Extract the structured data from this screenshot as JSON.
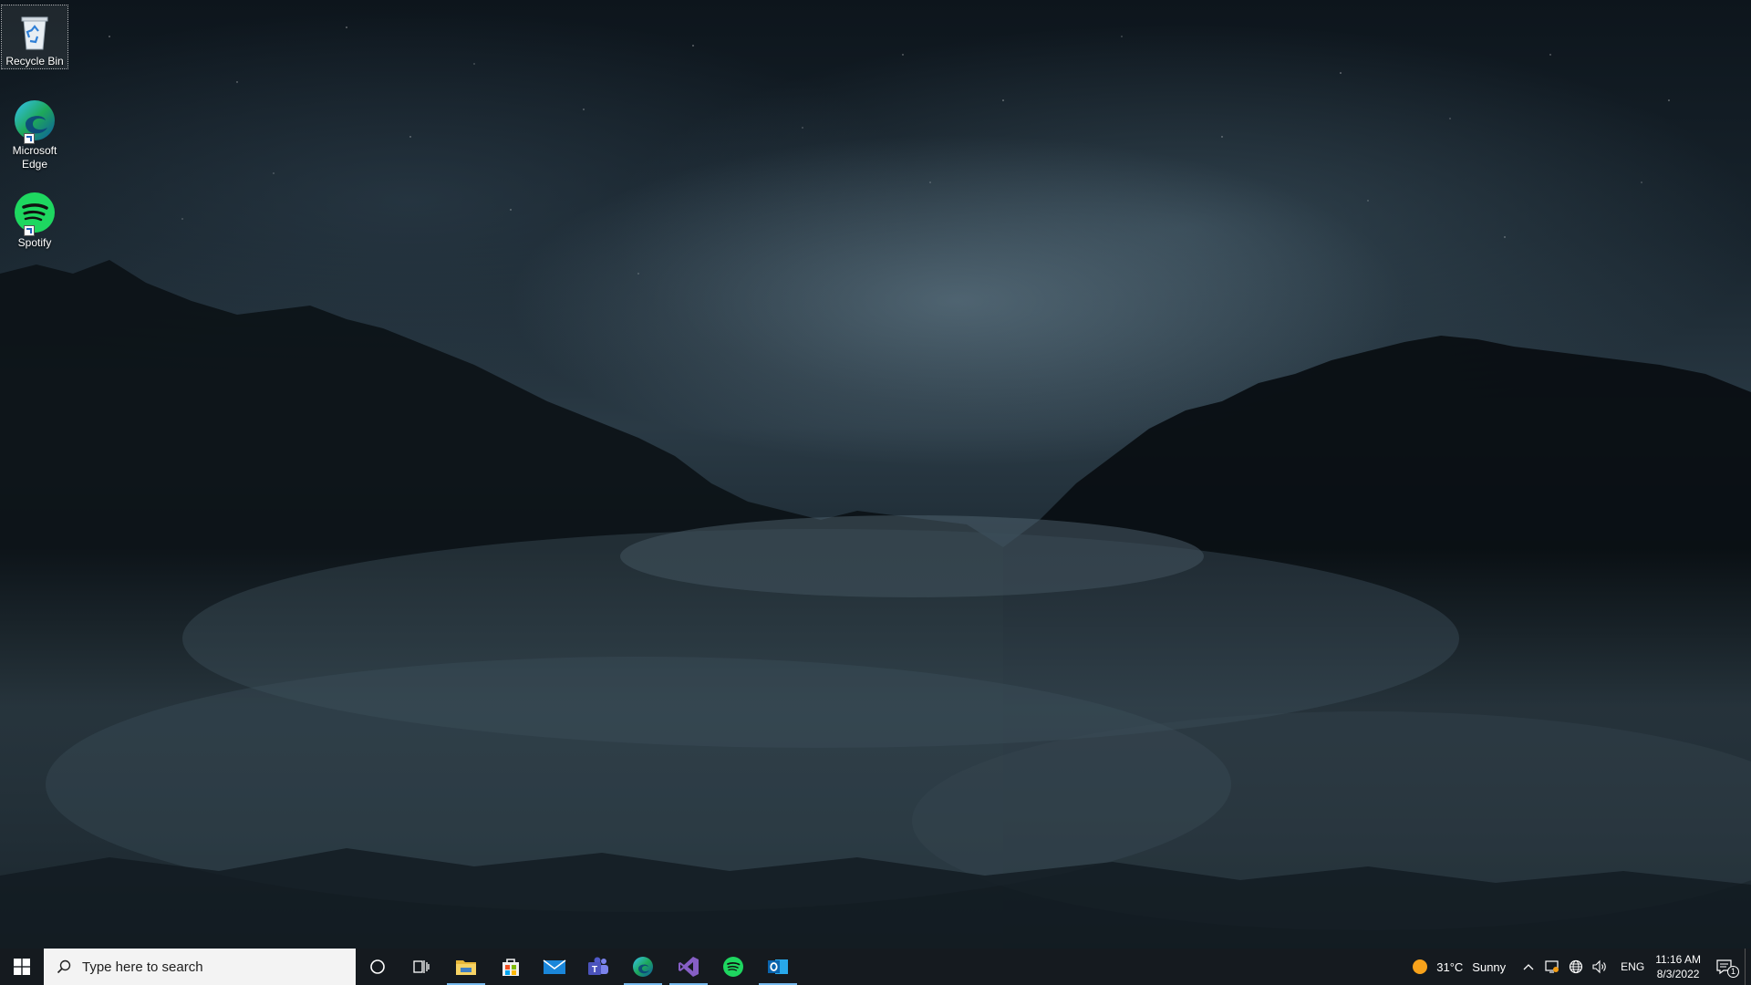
{
  "desktop": {
    "icons": [
      {
        "label": "Recycle Bin",
        "icon": "recycle-bin-icon"
      },
      {
        "label": "Microsoft Edge",
        "icon": "edge-icon"
      },
      {
        "label": "Spotify",
        "icon": "spotify-icon"
      }
    ]
  },
  "taskbar": {
    "start_icon": "windows-logo-icon",
    "search_placeholder": "Type here to search",
    "pinned": [
      {
        "name": "cortana",
        "icon": "cortana-circle-icon"
      },
      {
        "name": "task-view",
        "icon": "task-view-icon"
      },
      {
        "name": "file-explorer",
        "icon": "folder-icon",
        "running": true
      },
      {
        "name": "microsoft-store",
        "icon": "store-icon"
      },
      {
        "name": "mail",
        "icon": "mail-icon"
      },
      {
        "name": "teams",
        "icon": "teams-icon"
      },
      {
        "name": "edge",
        "icon": "edge-icon",
        "running": true
      },
      {
        "name": "visual-studio",
        "icon": "visual-studio-icon",
        "running": true
      },
      {
        "name": "spotify",
        "icon": "spotify-icon"
      },
      {
        "name": "outlook",
        "icon": "outlook-icon",
        "running": true
      }
    ],
    "weather": {
      "temperature": "31°C",
      "condition": "Sunny"
    },
    "language": "ENG",
    "time": "11:16 AM",
    "date": "8/3/2022",
    "notification_count": "1"
  },
  "colors": {
    "taskbar_bg": "#151a1f",
    "running_indicator": "#76b9ed",
    "search_bg": "#f3f3f3"
  }
}
